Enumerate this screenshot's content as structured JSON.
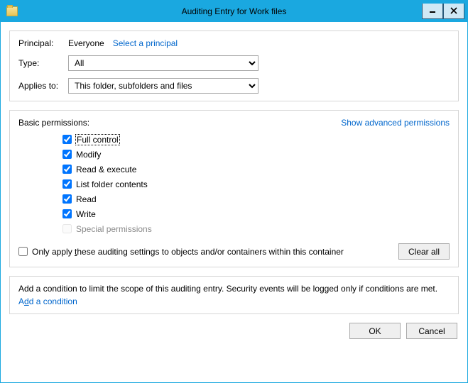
{
  "window": {
    "title": "Auditing Entry for Work files"
  },
  "principal": {
    "label": "Principal:",
    "value": "Everyone",
    "select_link": "Select a principal"
  },
  "type": {
    "label": "Type:",
    "value": "All"
  },
  "applies": {
    "label": "Applies to:",
    "value": "This folder, subfolders and files"
  },
  "permissions": {
    "heading": "Basic permissions:",
    "show_advanced": "Show advanced permissions",
    "items": {
      "full_control": "Full control",
      "modify": "Modify",
      "read_execute": "Read & execute",
      "list_folder": "List folder contents",
      "read": "Read",
      "write": "Write",
      "special": "Special permissions"
    },
    "only_apply_pre": "Only apply ",
    "only_apply_u": "t",
    "only_apply_post": "hese auditing settings to objects and/or containers within this container",
    "clear_all": "Clear all"
  },
  "condition": {
    "text": "Add a condition to limit the scope of this auditing entry. Security events will be logged only if conditions are met.",
    "add_pre": "A",
    "add_u": "d",
    "add_post": "d a condition"
  },
  "buttons": {
    "ok": "OK",
    "cancel": "Cancel"
  }
}
